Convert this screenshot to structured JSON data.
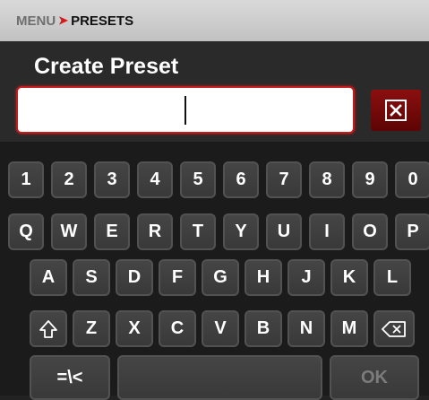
{
  "breadcrumb": {
    "menu": "MENU",
    "current": "PRESETS"
  },
  "dialog": {
    "title": "Create Preset",
    "input_value": ""
  },
  "keyboard": {
    "rows": [
      [
        "1",
        "2",
        "3",
        "4",
        "5",
        "6",
        "7",
        "8",
        "9",
        "0"
      ],
      [
        "Q",
        "W",
        "E",
        "R",
        "T",
        "Y",
        "U",
        "I",
        "O",
        "P"
      ],
      [
        "A",
        "S",
        "D",
        "F",
        "G",
        "H",
        "J",
        "K",
        "L"
      ],
      [
        "Z",
        "X",
        "C",
        "V",
        "B",
        "N",
        "M"
      ]
    ],
    "symbols_label": "=\\<",
    "ok_label": "OK"
  },
  "colors": {
    "accent": "#c21b1b",
    "key": "#3f3f3f",
    "background": "#222222"
  },
  "icons": {
    "clear": "close-box-icon",
    "shift": "shift-arrow-icon",
    "backspace": "backspace-icon"
  }
}
